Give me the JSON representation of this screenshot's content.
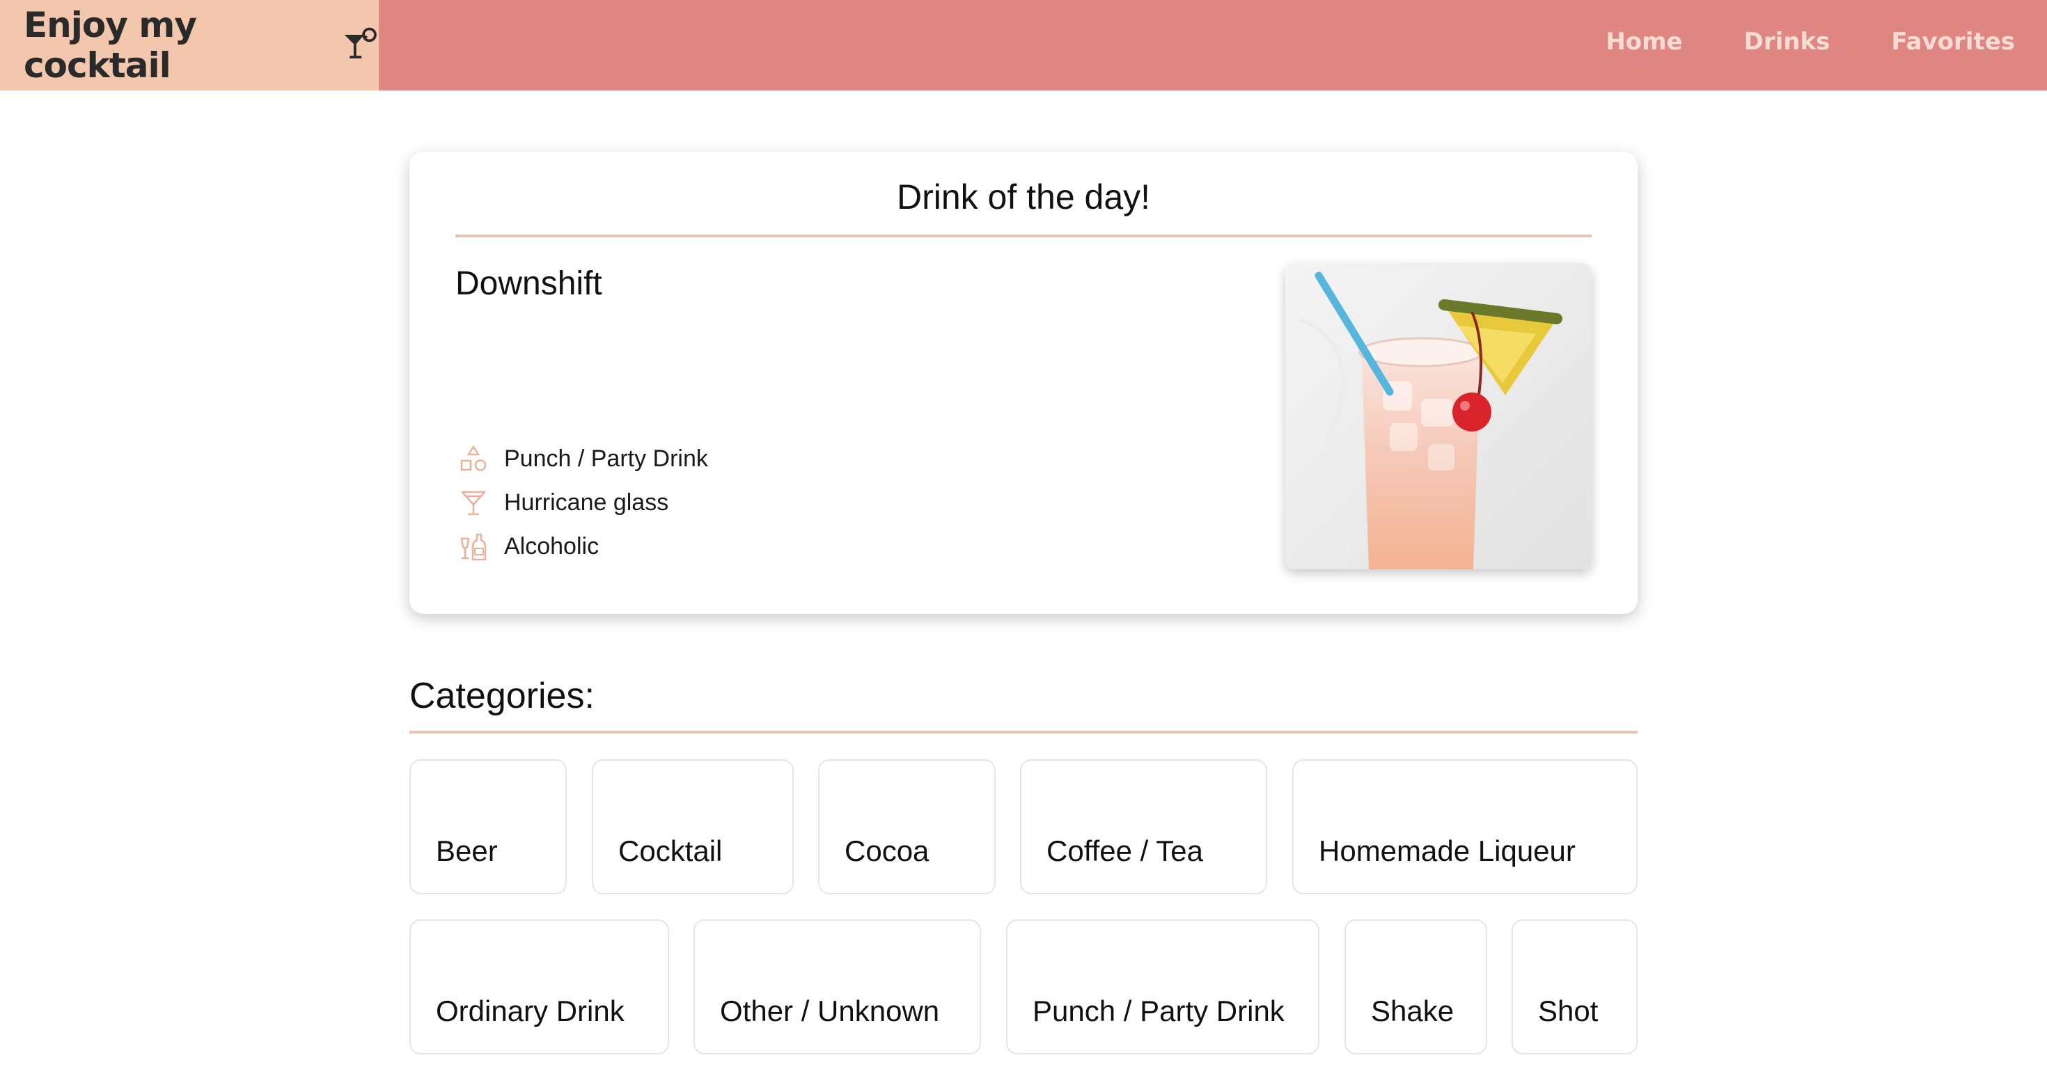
{
  "header": {
    "brand": "Enjoy my cocktail",
    "brand_icon": "cocktail-glass-icon",
    "nav": [
      "Home",
      "Drinks",
      "Favorites"
    ],
    "colors": {
      "bar": "#e08682",
      "brand_bg": "#f3c6ae",
      "nav_text": "#f6dcd3"
    }
  },
  "drink_of_day": {
    "heading": "Drink of the day!",
    "name": "Downshift",
    "category": "Punch / Party Drink",
    "glass": "Hurricane glass",
    "alcoholic": "Alcoholic",
    "icons": [
      "shapes-icon",
      "martini-glass-icon",
      "bottle-glass-icon"
    ],
    "image_desc": "cocktail-photo"
  },
  "categories": {
    "heading": "Categories:",
    "items": [
      "Beer",
      "Cocktail",
      "Cocoa",
      "Coffee / Tea",
      "Homemade Liqueur",
      "Ordinary Drink",
      "Other / Unknown",
      "Punch / Party Drink",
      "Shake",
      "Shot"
    ]
  },
  "accent_color": "#eac4b3"
}
